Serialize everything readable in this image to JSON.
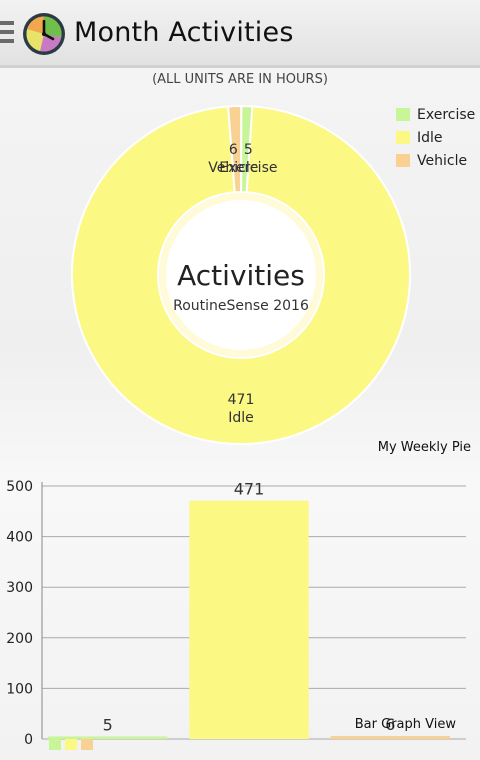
{
  "app": {
    "title": "Month Activities",
    "menu_icon": "hamburger-icon",
    "logo_icon": "clock-pie-icon"
  },
  "chart_note": "(ALL UNITS ARE IN HOURS)",
  "pie_caption": "My Weekly Pie",
  "bar_caption": "Bar Graph View",
  "colors": {
    "exercise": "#c8f598",
    "idle": "#fbf884",
    "vehicle": "#f9d193",
    "grid": "#aaaaaa"
  },
  "chart_data": [
    {
      "type": "pie",
      "title": "Activities",
      "subtitle": "RoutineSense 2016",
      "labels": [
        "Exercise",
        "Idle",
        "Vehicle"
      ],
      "values": [
        5,
        471,
        6
      ],
      "slice_labels": [
        "Exercise",
        "Idle",
        "Vehicle"
      ],
      "legend": [
        "Exercise",
        "Idle",
        "Vehicle"
      ],
      "legend_position": "top-right",
      "donut": true
    },
    {
      "type": "bar",
      "categories": [
        "Exercise",
        "Idle",
        "Vehicle"
      ],
      "values": [
        5,
        471,
        6
      ],
      "data_labels": [
        "5",
        "471",
        "6"
      ],
      "ylim": [
        0,
        500
      ],
      "yticks": [
        "0",
        "100",
        "200",
        "300",
        "400",
        "500"
      ],
      "grid": true,
      "legend_position": "bottom-left"
    }
  ]
}
